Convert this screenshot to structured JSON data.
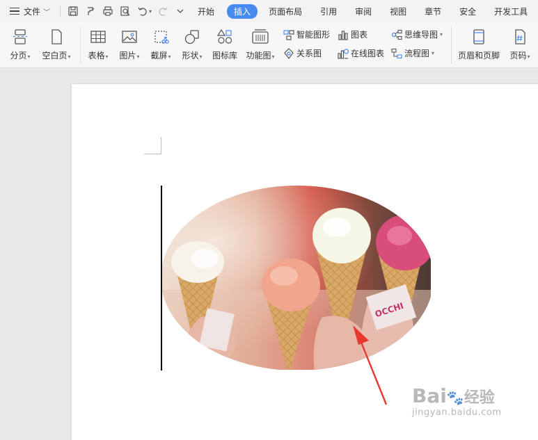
{
  "menubar": {
    "file_label": "文件",
    "tabs": [
      "开始",
      "插入",
      "页面布局",
      "引用",
      "审阅",
      "视图",
      "章节",
      "安全",
      "开发工具"
    ],
    "active_tab": "插入"
  },
  "ribbon": {
    "page_break": "分页",
    "blank_page": "空白页",
    "table": "表格",
    "picture": "图片",
    "screenshot": "截屏",
    "shape": "形状",
    "icon_library": "图标库",
    "function_chart": "功能图",
    "smart_art": "智能图形",
    "chart": "图表",
    "mind_map": "思维导图",
    "relation_chart": "关系图",
    "online_chart": "在线图表",
    "flow_chart": "流程图",
    "header_footer": "页眉和页脚",
    "page_number": "页码"
  },
  "photo": {
    "cone_text": "OCCHI"
  },
  "watermark": {
    "brand_a": "Bai",
    "brand_b": "经验",
    "sub": "jingyan.baidu.com"
  },
  "colors": {
    "accent": "#4a8bf1",
    "arrow": "#e8382f"
  }
}
